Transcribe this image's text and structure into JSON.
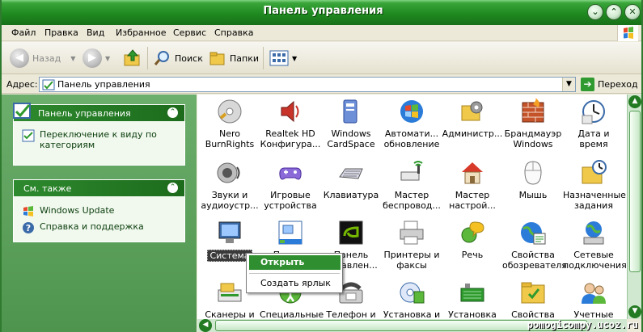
{
  "window": {
    "title": "Панель управления"
  },
  "menubar": [
    "Файл",
    "Правка",
    "Вид",
    "Избранное",
    "Сервис",
    "Справка"
  ],
  "toolbar": {
    "back": "Назад",
    "search": "Поиск",
    "folders": "Папки"
  },
  "address": {
    "label": "Адрес:",
    "value": "Панель управления",
    "go": "Переход"
  },
  "leftpane": {
    "panel_title": "Панель управления",
    "switch_view": "Переключение к виду по категориям",
    "see_also_title": "См. также",
    "links": [
      "Windows Update",
      "Справка и поддержка"
    ]
  },
  "items": [
    {
      "label": "Nero BurnRights",
      "icon": "nero-icon"
    },
    {
      "label": "Realtek HD Конфигура...",
      "icon": "speaker-icon"
    },
    {
      "label": "Windows CardSpace",
      "icon": "cardspace-icon"
    },
    {
      "label": "Автомати... обновление",
      "icon": "windows-update-icon"
    },
    {
      "label": "Администр...",
      "icon": "admin-tools-icon"
    },
    {
      "label": "Брандмауэр Windows",
      "icon": "firewall-icon"
    },
    {
      "label": "Дата и время",
      "icon": "clock-icon"
    },
    {
      "label": "Звуки и аудиоустр...",
      "icon": "sound-icon"
    },
    {
      "label": "Игровые устройства",
      "icon": "gamepad-icon"
    },
    {
      "label": "Клавиатура",
      "icon": "keyboard-icon"
    },
    {
      "label": "Мастер беспровод...",
      "icon": "wireless-icon"
    },
    {
      "label": "Мастер настрой...",
      "icon": "network-wizard-icon"
    },
    {
      "label": "Мышь",
      "icon": "mouse-icon"
    },
    {
      "label": "Назначенные задания",
      "icon": "scheduled-tasks-icon"
    },
    {
      "label": "Система",
      "icon": "system-icon"
    },
    {
      "label": "Панель задач...",
      "icon": "taskbar-icon"
    },
    {
      "label": "Панель управлен...",
      "icon": "nvidia-icon"
    },
    {
      "label": "Принтеры и факсы",
      "icon": "printer-icon"
    },
    {
      "label": "Речь",
      "icon": "speech-icon"
    },
    {
      "label": "Свойства обозревателя",
      "icon": "internet-options-icon"
    },
    {
      "label": "Сетевые подключения",
      "icon": "network-connections-icon"
    },
    {
      "label": "Сканеры и",
      "icon": "scanner-icon"
    },
    {
      "label": "Специальные",
      "icon": "accessibility-icon"
    },
    {
      "label": "Телефон и",
      "icon": "phone-icon"
    },
    {
      "label": "Установка и",
      "icon": "add-remove-icon"
    },
    {
      "label": "Установка",
      "icon": "add-hardware-icon"
    },
    {
      "label": "Свойства",
      "icon": "folder-options-icon"
    },
    {
      "label": "Учетные",
      "icon": "user-accounts-icon"
    }
  ],
  "context_menu": {
    "open": "Открыть",
    "create_shortcut": "Создать ярлык"
  },
  "watermark": "pomogicompy.ucoz.ru",
  "colors": {
    "accent": "#1f8a1f",
    "selection": "#2f8e2f",
    "pane": "#5a9f5a"
  }
}
